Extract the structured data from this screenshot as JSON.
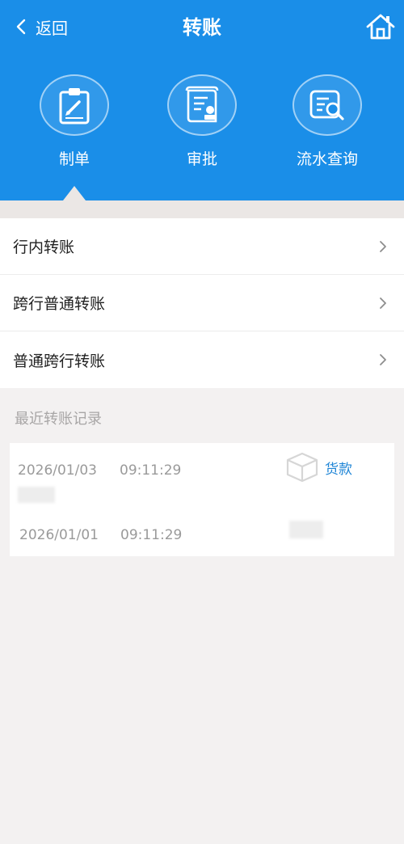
{
  "header": {
    "back_label": "返回",
    "title": "转账",
    "accent_color": "#1a8ee8"
  },
  "nav": [
    {
      "label": "制单",
      "icon": "clipboard-edit-icon"
    },
    {
      "label": "审批",
      "icon": "document-stamp-icon"
    },
    {
      "label": "流水查询",
      "icon": "document-search-icon"
    }
  ],
  "menu": [
    {
      "label": "行内转账"
    },
    {
      "label": "跨行普通转账"
    },
    {
      "label": "普通跨行转账"
    }
  ],
  "recent": {
    "title": "最近转账记录",
    "records": [
      {
        "date": "2026/01/03",
        "time": "09:11:29",
        "purpose": "货款"
      },
      {
        "date": "2026/01/01",
        "time": "09:11:29",
        "purpose": ""
      }
    ]
  }
}
